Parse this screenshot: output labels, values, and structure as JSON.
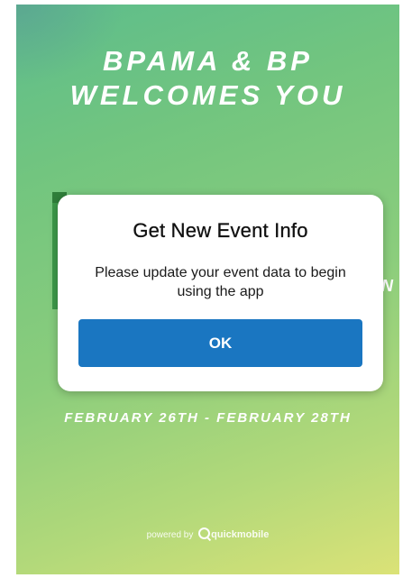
{
  "background": {
    "welcome_line1": "BPAMA & BP",
    "welcome_line2": "WELCOMES YOU",
    "dates": "FEBRUARY 26TH - FEBRUARY 28TH",
    "powered_by": "powered by",
    "brand": "quickmobile",
    "partial_letter": "N"
  },
  "dialog": {
    "title": "Get New Event Info",
    "message": "Please update your event data to begin using the app",
    "ok_label": "OK"
  },
  "colors": {
    "button": "#1a76c1",
    "gradient_top": "#5dbd8c",
    "gradient_bottom": "#dbe277"
  }
}
